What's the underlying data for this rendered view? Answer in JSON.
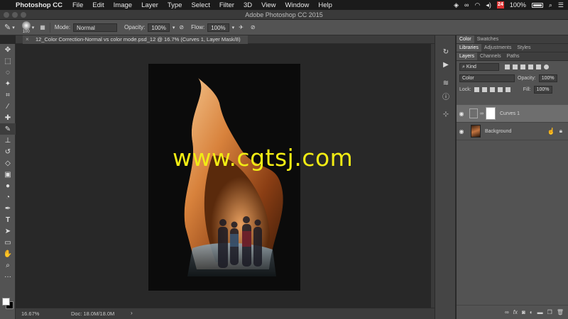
{
  "menubar": {
    "apple_glyph": "",
    "app_name": "Photoshop CC",
    "items": [
      "File",
      "Edit",
      "Image",
      "Layer",
      "Type",
      "Select",
      "Filter",
      "3D",
      "View",
      "Window",
      "Help"
    ],
    "battery_percent": "100%",
    "calendar_day": "24"
  },
  "window": {
    "title": "Adobe Photoshop CC 2015"
  },
  "options": {
    "brush_size": "100",
    "mode_label": "Mode:",
    "mode_value": "Normal",
    "opacity_label": "Opacity:",
    "opacity_value": "100%",
    "flow_label": "Flow:",
    "flow_value": "100%"
  },
  "document": {
    "tab_title": "12_Color Correction-Normal vs color mode.psd_12 @ 16.7% (Curves 1, Layer Mask/8)",
    "close_glyph": "×"
  },
  "watermark": "www.cgtsj.com",
  "status": {
    "zoom": "16.67%",
    "doc_info": "Doc: 18.0M/18.0M",
    "arrow": "›"
  },
  "panels": {
    "row1_tabs": [
      "Color",
      "Swatches"
    ],
    "row2_tabs": [
      "Libraries",
      "Adjustments",
      "Styles"
    ],
    "row3_tabs": [
      "Layers",
      "Channels",
      "Paths"
    ],
    "kind_label": "Kind",
    "blend_mode": "Color",
    "opacity_label": "Opacity:",
    "opacity_value": "100%",
    "lock_label": "Lock:",
    "fill_label": "Fill:",
    "fill_value": "100%",
    "layers": [
      {
        "name": "Curves 1"
      },
      {
        "name": "Background"
      }
    ]
  },
  "colors": {
    "watermark": "#f2ec14",
    "selected_layer": "#6e6e6e"
  }
}
